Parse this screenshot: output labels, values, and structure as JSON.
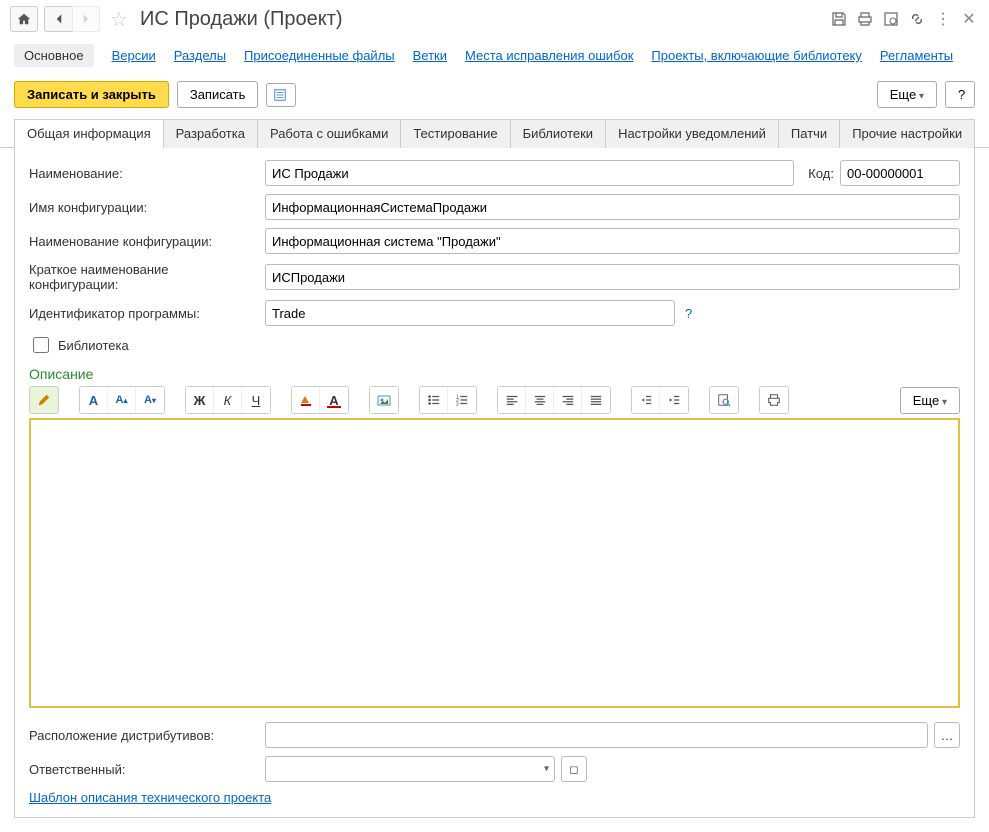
{
  "header": {
    "title": "ИС Продажи (Проект)"
  },
  "nav": {
    "active": "Основное",
    "links": [
      "Версии",
      "Разделы",
      "Присоединенные файлы",
      "Ветки",
      "Места исправления ошибок",
      "Проекты, включающие библиотеку",
      "Регламенты"
    ]
  },
  "actions": {
    "save_close": "Записать и закрыть",
    "save": "Записать",
    "more": "Еще",
    "help": "?"
  },
  "tabs": [
    "Общая информация",
    "Разработка",
    "Работа с ошибками",
    "Тестирование",
    "Библиотеки",
    "Настройки уведомлений",
    "Патчи",
    "Прочие настройки"
  ],
  "form": {
    "name_label": "Наименование:",
    "name_value": "ИС Продажи",
    "code_label": "Код:",
    "code_value": "00-00000001",
    "config_name_label": "Имя конфигурации:",
    "config_name_value": "ИнформационнаяСистемаПродажи",
    "config_title_label": "Наименование конфигурации:",
    "config_title_value": "Информационная система \"Продажи\"",
    "config_short_label": "Краткое наименование конфигурации:",
    "config_short_value": "ИСПродажи",
    "prog_id_label": "Идентификатор программы:",
    "prog_id_value": "Trade",
    "library_label": "Библиотека",
    "description_heading": "Описание",
    "editor_more": "Еще",
    "distrib_label": "Расположение дистрибутивов:",
    "distrib_value": "",
    "responsible_label": "Ответственный:",
    "responsible_value": "",
    "template_link": "Шаблон описания технического проекта"
  },
  "editor_icons": {
    "pencil": "pencil",
    "font": "A",
    "font_plus": "A",
    "font_minus": "A",
    "bold": "Ж",
    "italic": "К",
    "underline": "Ч",
    "highlight": "hl",
    "text_color": "tc",
    "picture": "pic",
    "bullets": "ul",
    "numbers": "ol",
    "align_left": "al",
    "align_center": "ac",
    "align_right": "ar",
    "align_just": "aj",
    "indent_dec": "id",
    "indent_inc": "ii",
    "find": "find",
    "print": "print"
  }
}
